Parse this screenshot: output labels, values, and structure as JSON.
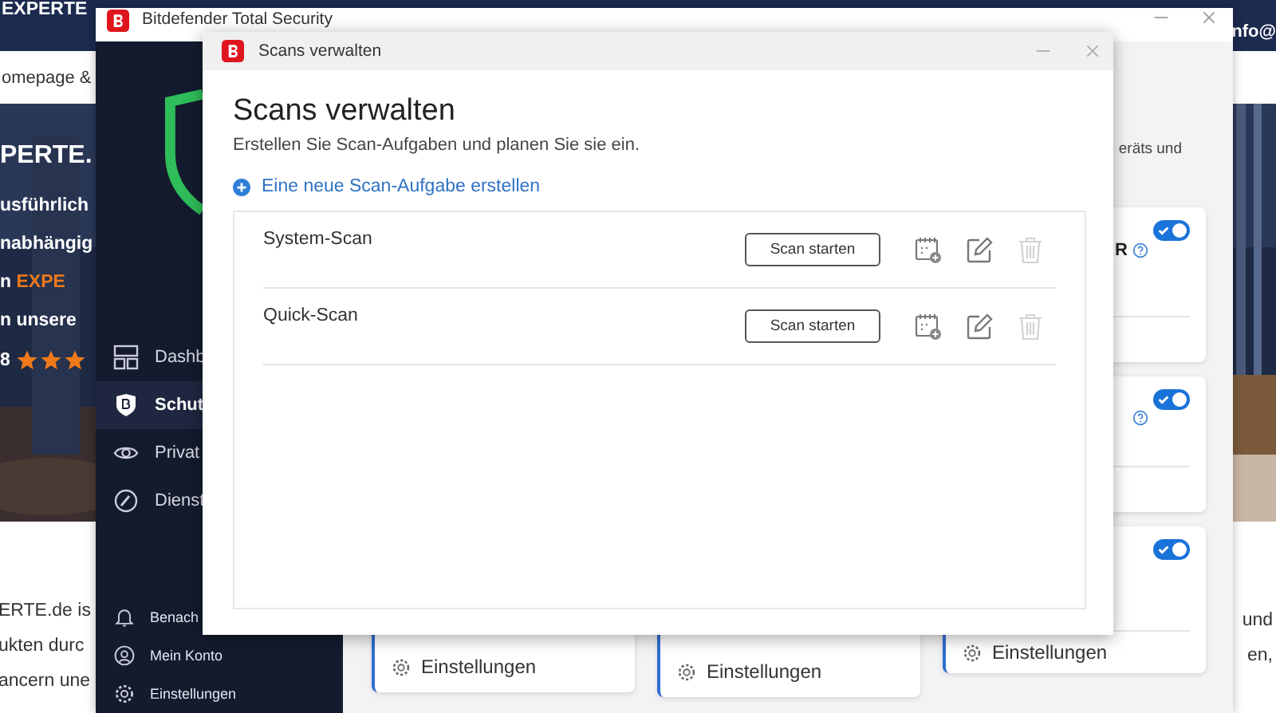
{
  "website": {
    "logo": "EXPERTE",
    "contact": "nfo@",
    "nav_text": "omepage &",
    "hero": {
      "heading": "PERTE.",
      "lines": [
        {
          "text": "usführlich"
        },
        {
          "text": "nabhängig"
        },
        {
          "text": "n ",
          "accent": "EXPE"
        },
        {
          "text": "n unsere"
        }
      ],
      "rating": "8",
      "stars": 3
    },
    "body_lines": [
      "ERTE.de is",
      "ukten durc",
      "ancern une"
    ],
    "right_lines": [
      "und",
      "en,"
    ]
  },
  "main_window": {
    "title": "Bitdefender Total Security",
    "nav": [
      {
        "label": "Dashb",
        "selected": false
      },
      {
        "label": "Schut",
        "selected": true
      },
      {
        "label": "Privat",
        "selected": false
      },
      {
        "label": "Dienst",
        "selected": false
      }
    ],
    "bottom_nav": [
      "Benach",
      "Mein Konto",
      "Einstellungen"
    ],
    "description": "eräts und",
    "right_cards": [
      {
        "title": "R",
        "help": true,
        "on": true
      },
      {
        "help": true,
        "on": true
      },
      {
        "help": false,
        "on": true,
        "footer": "Einstellungen"
      }
    ],
    "bottom_cards": [
      {
        "footer": "Einstellungen"
      },
      {
        "footer": "Einstellungen"
      }
    ]
  },
  "dialog": {
    "title": "Scans verwalten",
    "heading": "Scans verwalten",
    "subtitle": "Erstellen Sie Scan-Aufgaben und planen Sie sie ein.",
    "add_link": "Eine neue Scan-Aufgabe erstellen",
    "scans": [
      {
        "name": "System-Scan",
        "button": "Scan starten",
        "delete_disabled": true
      },
      {
        "name": "Quick-Scan",
        "button": "Scan starten",
        "delete_disabled": true
      }
    ]
  }
}
